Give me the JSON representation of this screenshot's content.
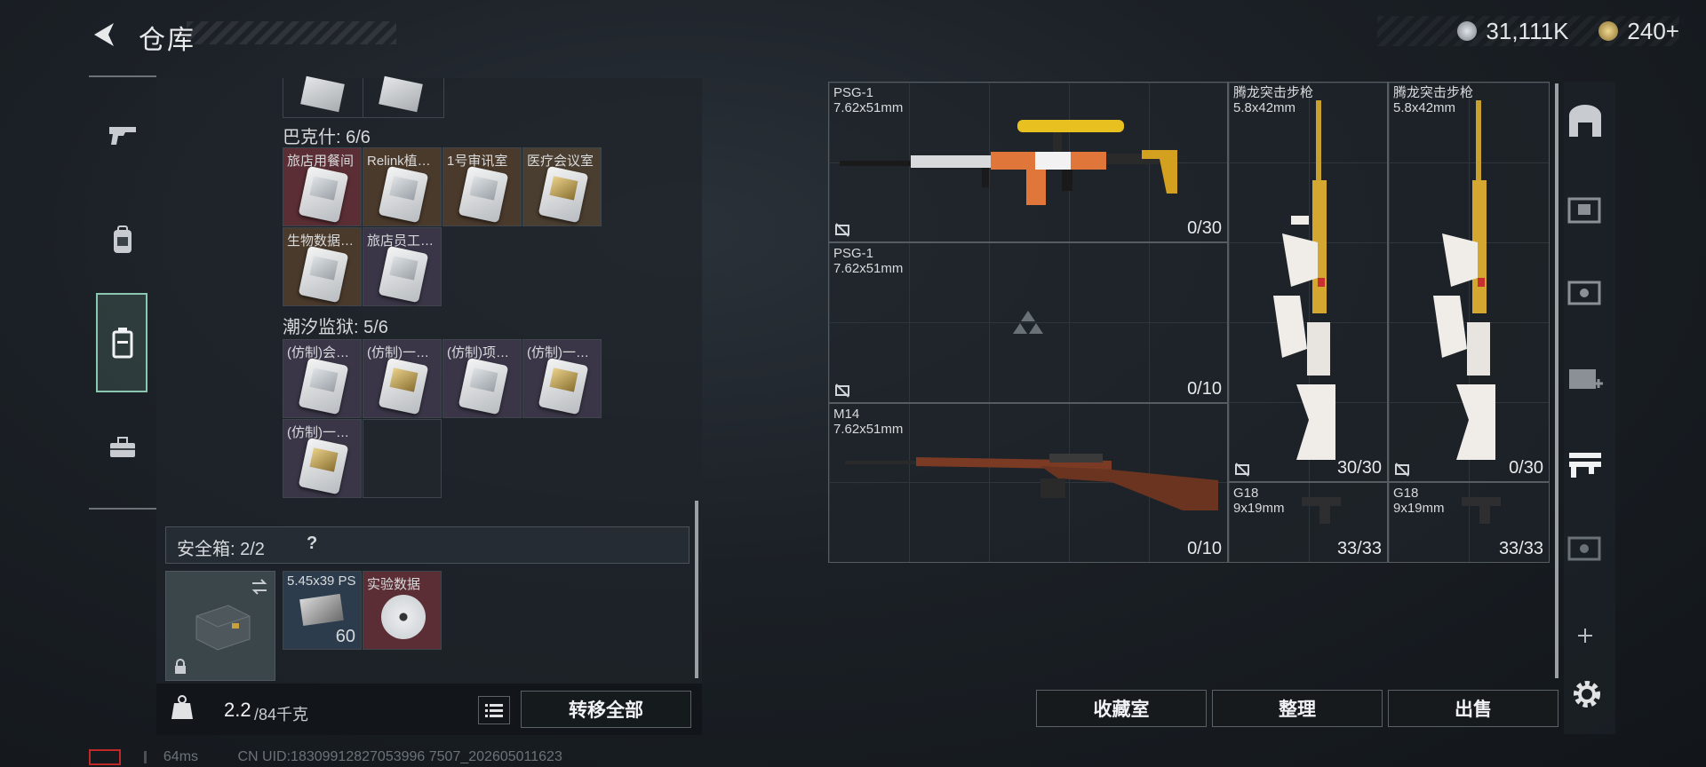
{
  "header": {
    "title": "仓库",
    "back_icon": "back-arrow-icon"
  },
  "currency": {
    "silver": {
      "icon": "silver-coin-icon",
      "value": "31,111K"
    },
    "gold": {
      "icon": "gold-coin-icon",
      "value": "240+"
    }
  },
  "left_nav": [
    {
      "name": "weapons",
      "icon": "gun-icon"
    },
    {
      "name": "gear",
      "icon": "backpack-icon"
    },
    {
      "name": "storage",
      "icon": "container-icon",
      "active": true
    },
    {
      "name": "tools",
      "icon": "toolbox-icon"
    }
  ],
  "sections": [
    {
      "label": "巴克什: 6/6",
      "items": [
        "旅店用餐间",
        "Relink植…",
        "1号审讯室",
        "医疗会议室",
        "生物数据…",
        "旅店员工…"
      ]
    },
    {
      "label": "潮汐监狱: 5/6",
      "items": [
        "(仿制)会…",
        "(仿制)一…",
        "(仿制)项…",
        "(仿制)一…",
        "(仿制)一…"
      ]
    }
  ],
  "safe_box": {
    "label": "安全箱: 2/2",
    "help": "?",
    "items": [
      {
        "label": "5.45x39 PS",
        "count": "60"
      },
      {
        "label": "实验数据",
        "count": ""
      }
    ]
  },
  "bottom": {
    "weight": "2.2",
    "weight_max": "/84千克",
    "transfer_all": "转移全部"
  },
  "weapons": [
    {
      "name": "PSG-1",
      "caliber": "7.62x51mm",
      "count": "0/30"
    },
    {
      "name": "PSG-1",
      "caliber": "7.62x51mm",
      "count": "0/10"
    },
    {
      "name": "M14",
      "caliber": "7.62x51mm",
      "count": "0/10"
    },
    {
      "name": "腾龙突击步枪",
      "caliber": "5.8x42mm",
      "count": "30/30"
    },
    {
      "name": "腾龙突击步枪",
      "caliber": "5.8x42mm",
      "count": "0/30"
    },
    {
      "name": "G18",
      "caliber": "9x19mm",
      "count": "33/33"
    },
    {
      "name": "G18",
      "caliber": "9x19mm",
      "count": "33/33"
    }
  ],
  "right_buttons": {
    "collection": "收藏室",
    "sort": "整理",
    "sell": "出售"
  },
  "right_side": [
    {
      "icon": "storage-bay-icon"
    },
    {
      "icon": "storage-level-3-icon"
    },
    {
      "icon": "storage-level-4-icon"
    },
    {
      "icon": "storage-level-2-icon"
    },
    {
      "icon": "weapon-rack-icon"
    },
    {
      "icon": "storage-level-5-icon"
    },
    {
      "icon": "add-icon"
    },
    {
      "icon": "settings-icon"
    }
  ],
  "footer": {
    "ping": "64ms",
    "uid": "CN UID:18309912827053996 7507_202605011623"
  }
}
